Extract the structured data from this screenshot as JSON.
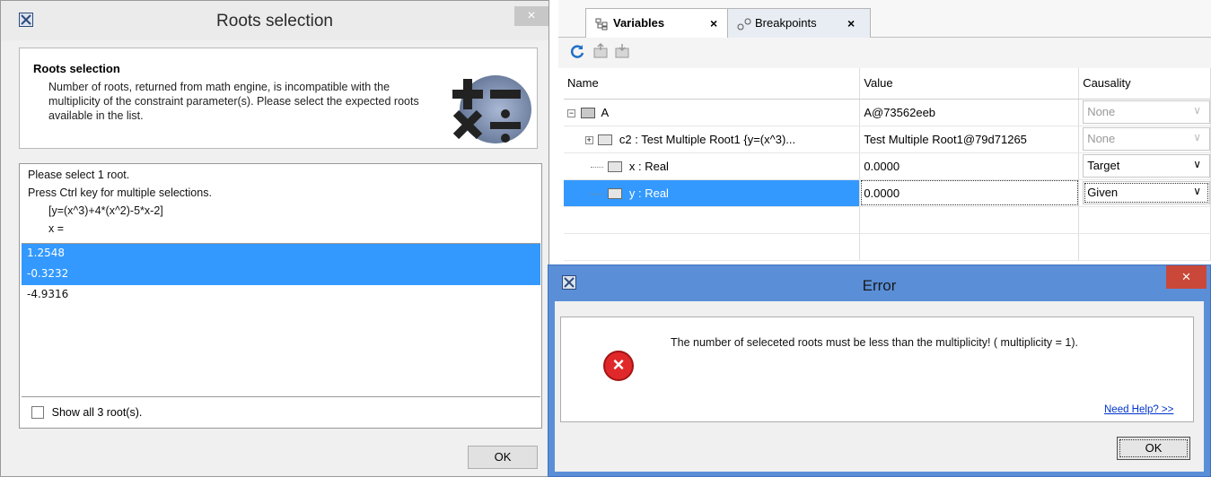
{
  "roots_dialog": {
    "title": "Roots selection",
    "close_glyph": "×",
    "header_title": "Roots selection",
    "header_description": "Number of roots, returned from math engine, is incompatible with the multiplicity of the constraint parameter(s). Please select the expected roots available in the list.",
    "prompt": [
      "Please select 1 root.",
      "Press Ctrl key for multiple selections.",
      "[y=(x^3)+4*(x^2)-5*x-2]",
      "x ="
    ],
    "roots": [
      {
        "value": "1.2548",
        "selected": true
      },
      {
        "value": "-0.3232",
        "selected": true
      },
      {
        "value": "-4.9316",
        "selected": false
      }
    ],
    "show_all_label": "Show all 3 root(s).",
    "ok_label": "OK",
    "icons": [
      "app-icon",
      "math-operators-icon"
    ]
  },
  "variables_panel": {
    "tabs": [
      {
        "label": "Variables",
        "icon": "variables-icon",
        "close": "×",
        "active": true
      },
      {
        "label": "Breakpoints",
        "icon": "breakpoints-icon",
        "close": "×",
        "active": false
      }
    ],
    "toolbar_icons": [
      "refresh-icon",
      "export-icon",
      "import-icon"
    ],
    "columns": [
      "Name",
      "Value",
      "Causality"
    ],
    "rows": [
      {
        "name": "A",
        "value": "A@73562eeb",
        "causality": "None",
        "expander": "−",
        "causality_enabled": false
      },
      {
        "name": "c2 : Test Multiple Root1 {y=(x^3)...",
        "value": "Test Multiple Root1@79d71265",
        "causality": "None",
        "expander": "+",
        "causality_enabled": false
      },
      {
        "name": "x : Real",
        "value": "0.0000",
        "causality": "Target",
        "causality_enabled": true
      },
      {
        "name": "y : Real",
        "value": "0.0000",
        "causality": "Given",
        "causality_enabled": true,
        "selected": true
      }
    ],
    "dropdown_glyph": "∨"
  },
  "error_dialog": {
    "title": "Error",
    "close_glyph": "×",
    "message": "The number of seleceted roots must be less than the multiplicity! ( multiplicity = 1).",
    "help_link": "Need Help? >>",
    "ok_label": "OK",
    "icon_glyph": "×"
  },
  "colors": {
    "selection": "#3399ff",
    "error_frame": "#5a8fd8",
    "error_close": "#c9483a",
    "error_icon": "#e0282a",
    "link": "#0033cc"
  }
}
